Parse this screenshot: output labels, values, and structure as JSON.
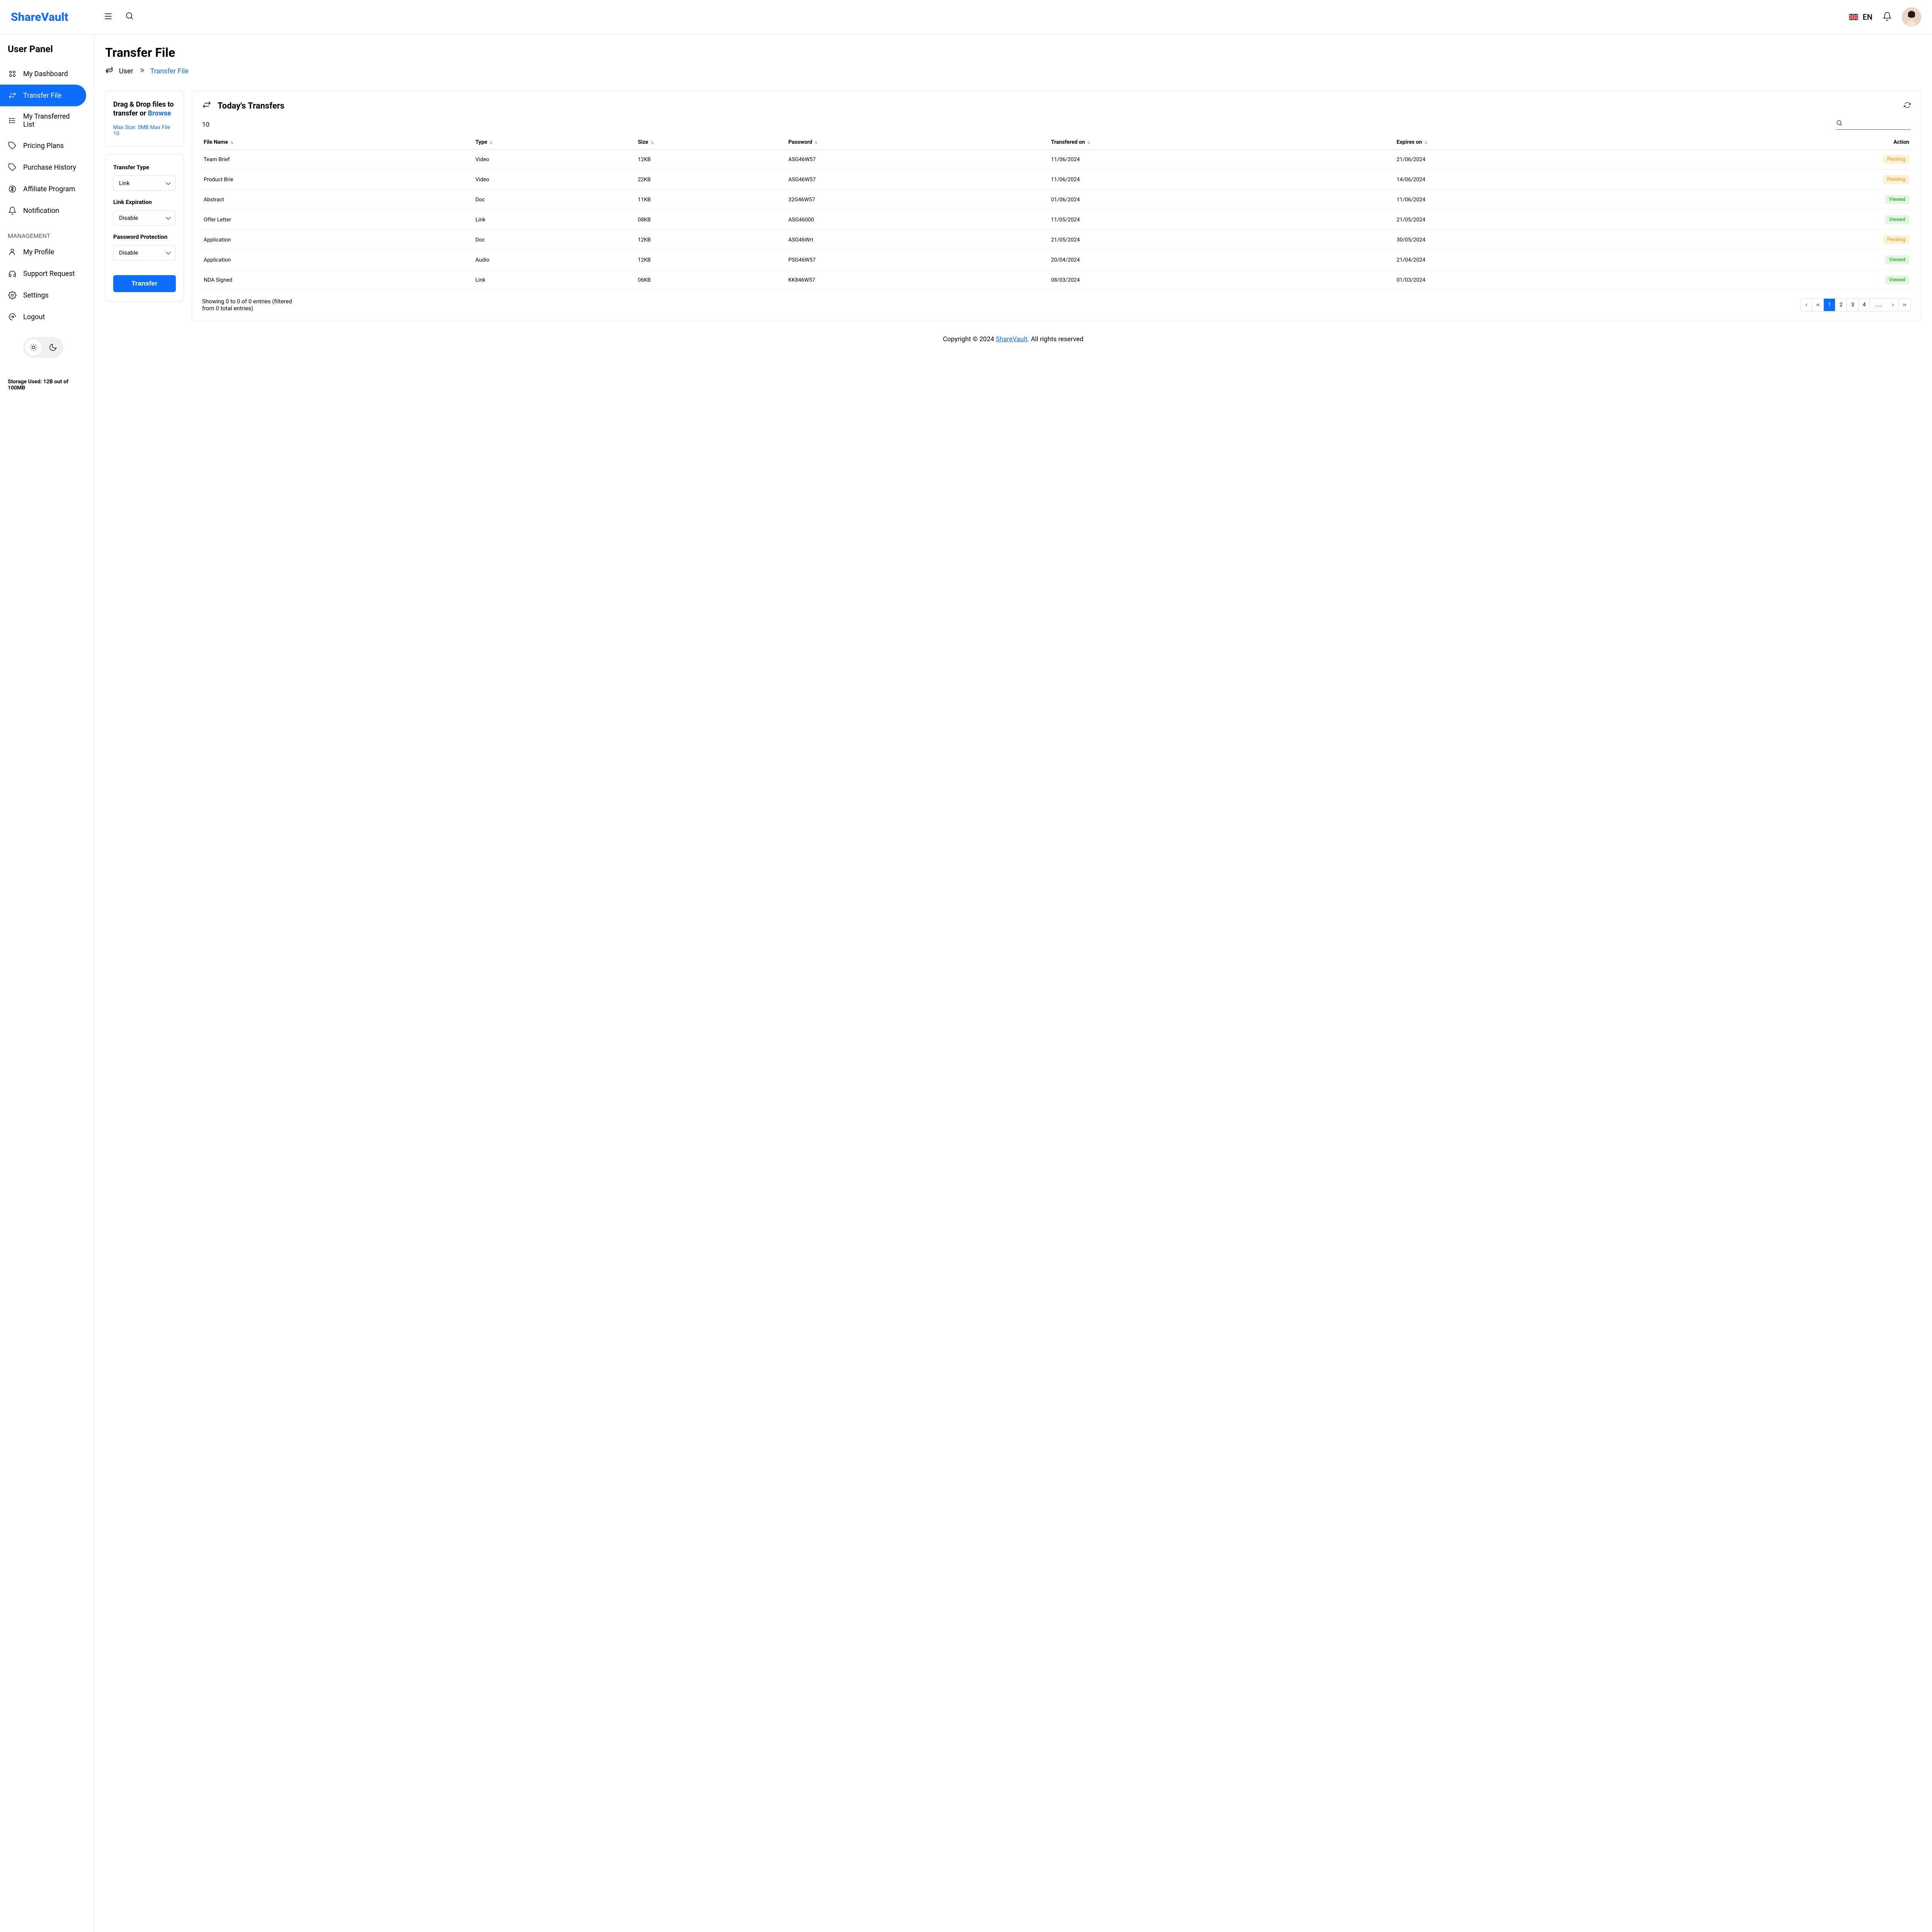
{
  "header": {
    "logo": "ShareVault",
    "language": "EN"
  },
  "sidebar": {
    "panel_title": "User Panel",
    "nav_items": [
      {
        "label": "My Dashboard",
        "icon": "dashboard"
      },
      {
        "label": "Transfer File",
        "icon": "transfer",
        "active": true
      },
      {
        "label": "My Transferred List",
        "icon": "list"
      },
      {
        "label": "Pricing Plans",
        "icon": "pricing"
      },
      {
        "label": "Purchase History",
        "icon": "tag"
      },
      {
        "label": "Affiliate Program",
        "icon": "dollar"
      },
      {
        "label": "Notification",
        "icon": "bell"
      }
    ],
    "management_label": "MANAGEMENT",
    "management_items": [
      {
        "label": "My Profile",
        "icon": "profile"
      },
      {
        "label": "Support Request",
        "icon": "support"
      },
      {
        "label": "Settings",
        "icon": "gear"
      },
      {
        "label": "Logout",
        "icon": "logout"
      }
    ],
    "storage": "Storage Used: 12B out of 100MB"
  },
  "page": {
    "title": "Transfer File",
    "breadcrumb": {
      "root": "User",
      "current": "Transfer File"
    }
  },
  "dropzone": {
    "title_pre": "Drag & Drop files to transfer or ",
    "browse": "Browse",
    "sub": "Max Size: 5MB Max File 10"
  },
  "form": {
    "transfer_type_label": "Transfer Type",
    "transfer_type_value": "Link",
    "link_exp_label": "Link Expiration",
    "link_exp_value": "Disable",
    "pwd_label": "Password Protection",
    "pwd_value": "Disable",
    "submit": "Transfer"
  },
  "table": {
    "title": "Today's Transfers",
    "page_size": "10",
    "columns": [
      "File Name",
      "Type",
      "Size",
      "Password",
      "Transfered on",
      "Expires on",
      "Action"
    ],
    "rows": [
      {
        "file": "Team Brief",
        "type": "Video",
        "size": "12KB",
        "password": "ASG46W57",
        "transfered": "11/06/2024",
        "expires": "21/06/2024",
        "status": "Pending"
      },
      {
        "file": "Product Brie",
        "type": "Video",
        "size": "22KB",
        "password": "ASG46W57",
        "transfered": "11/06/2024",
        "expires": "14/06/2024",
        "status": "Pending"
      },
      {
        "file": "Abstract",
        "type": "Doc",
        "size": "11KB",
        "password": "32G46W57",
        "transfered": "01/06/2024",
        "expires": "11/06/2024",
        "status": "Viewed"
      },
      {
        "file": "Offer Letter",
        "type": "Link",
        "size": "08KB",
        "password": "ASG46000",
        "transfered": "11/05/2024",
        "expires": "21/05/2024",
        "status": "Viewed"
      },
      {
        "file": "Application",
        "type": "Doc",
        "size": "12KB",
        "password": "ASG46Wrt",
        "transfered": "21/05/2024",
        "expires": "30/05/2024",
        "status": "Pending"
      },
      {
        "file": "Application",
        "type": "Audio",
        "size": "12KB",
        "password": "PSG46W57",
        "transfered": "20/04/2024",
        "expires": "21/04/2024",
        "status": "Viewed"
      },
      {
        "file": "NDA Signed",
        "type": "Link",
        "size": "06KB",
        "password": "KK846W57",
        "transfered": "08/03/2024",
        "expires": "01/03/2024",
        "status": "Viewed"
      }
    ],
    "showing": "Showing 0 to 0 of 0 entries (filtered from 0 total entries)",
    "pages": [
      "1",
      "2",
      "3",
      "4",
      "....."
    ]
  },
  "footer": {
    "pre": "Copyright © 2024 ",
    "link": "ShareVault",
    "post": ". All rights reserved"
  }
}
